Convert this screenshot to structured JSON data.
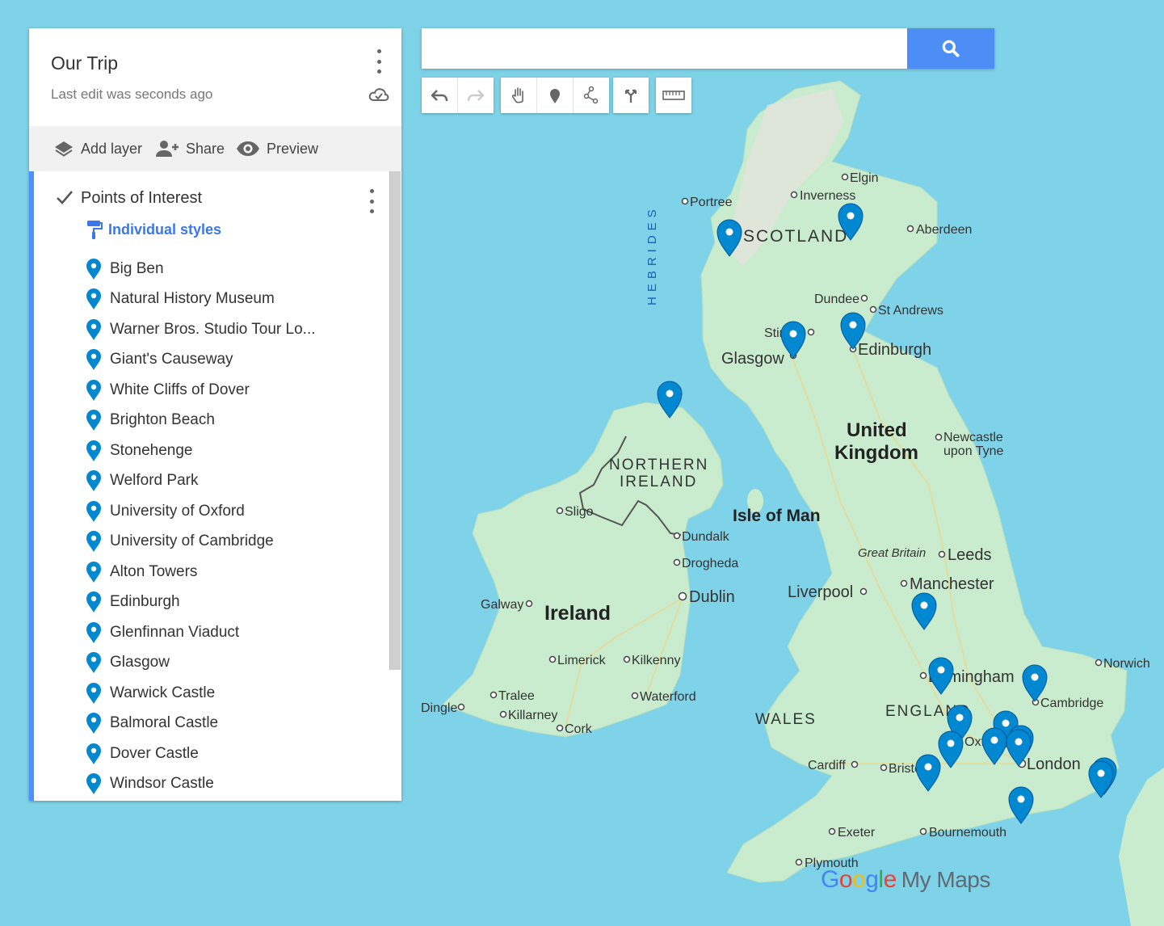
{
  "map_title": "Our Trip",
  "last_edit": "Last edit was seconds ago",
  "toolbar": {
    "add_layer": "Add layer",
    "share": "Share",
    "preview": "Preview"
  },
  "layer": {
    "title": "Points of Interest",
    "styles_label": "Individual styles",
    "places": [
      "Big Ben",
      "Natural History Museum",
      "Warner Bros. Studio Tour Lo...",
      "Giant's Causeway",
      "White Cliffs of Dover",
      "Brighton Beach",
      "Stonehenge",
      "Welford Park",
      "University of Oxford",
      "University of Cambridge",
      "Alton Towers",
      "Edinburgh",
      "Glenfinnan Viaduct",
      "Glasgow",
      "Warwick Castle",
      "Balmoral Castle",
      "Dover Castle",
      "Windsor Castle"
    ]
  },
  "search": {
    "value": "",
    "placeholder": ""
  },
  "colors": {
    "pin": "#0288d1",
    "accent": "#4d90fe",
    "water": "#7fd3e8",
    "land": "#c9ecce"
  },
  "map_labels": {
    "scotland": "SCOTLAND",
    "hebrides": "HEBRIDES",
    "northern_ireland_1": "NORTHERN",
    "northern_ireland_2": "IRELAND",
    "united_kingdom_1": "United",
    "united_kingdom_2": "Kingdom",
    "isle_of_man": "Isle of Man",
    "ireland": "Ireland",
    "wales": "WALES",
    "england": "ENGLAND",
    "great_britain": "Great Britain",
    "elgin": "Elgin",
    "inverness": "Inverness",
    "portree": "Portree",
    "aberdeen": "Aberdeen",
    "dundee": "Dundee",
    "st_andrews": "St Andrews",
    "stirling": "Stirling",
    "glasgow": "Glasgow",
    "edinburgh": "Edinburgh",
    "newcastle_1": "Newcastle",
    "newcastle_2": "upon Tyne",
    "sligo": "Sligo",
    "dundalk": "Dundalk",
    "drogheda": "Drogheda",
    "dublin": "Dublin",
    "galway": "Galway",
    "limerick": "Limerick",
    "kilkenny": "Kilkenny",
    "tralee": "Tralee",
    "killarney": "Killarney",
    "waterford": "Waterford",
    "cork": "Cork",
    "dingle": "Dingle",
    "leeds": "Leeds",
    "manchester": "Manchester",
    "liverpool": "Liverpool",
    "birmingham": "Birmingham",
    "norwich": "Norwich",
    "cambridge": "Cambridge",
    "oxford": "Oxford",
    "london": "London",
    "cardiff": "Cardiff",
    "bristol": "Bristol",
    "exeter": "Exeter",
    "bournemouth": "Bournemouth",
    "plymouth": "Plymouth"
  },
  "logo": {
    "google": "Google",
    "my_maps": "My Maps"
  }
}
